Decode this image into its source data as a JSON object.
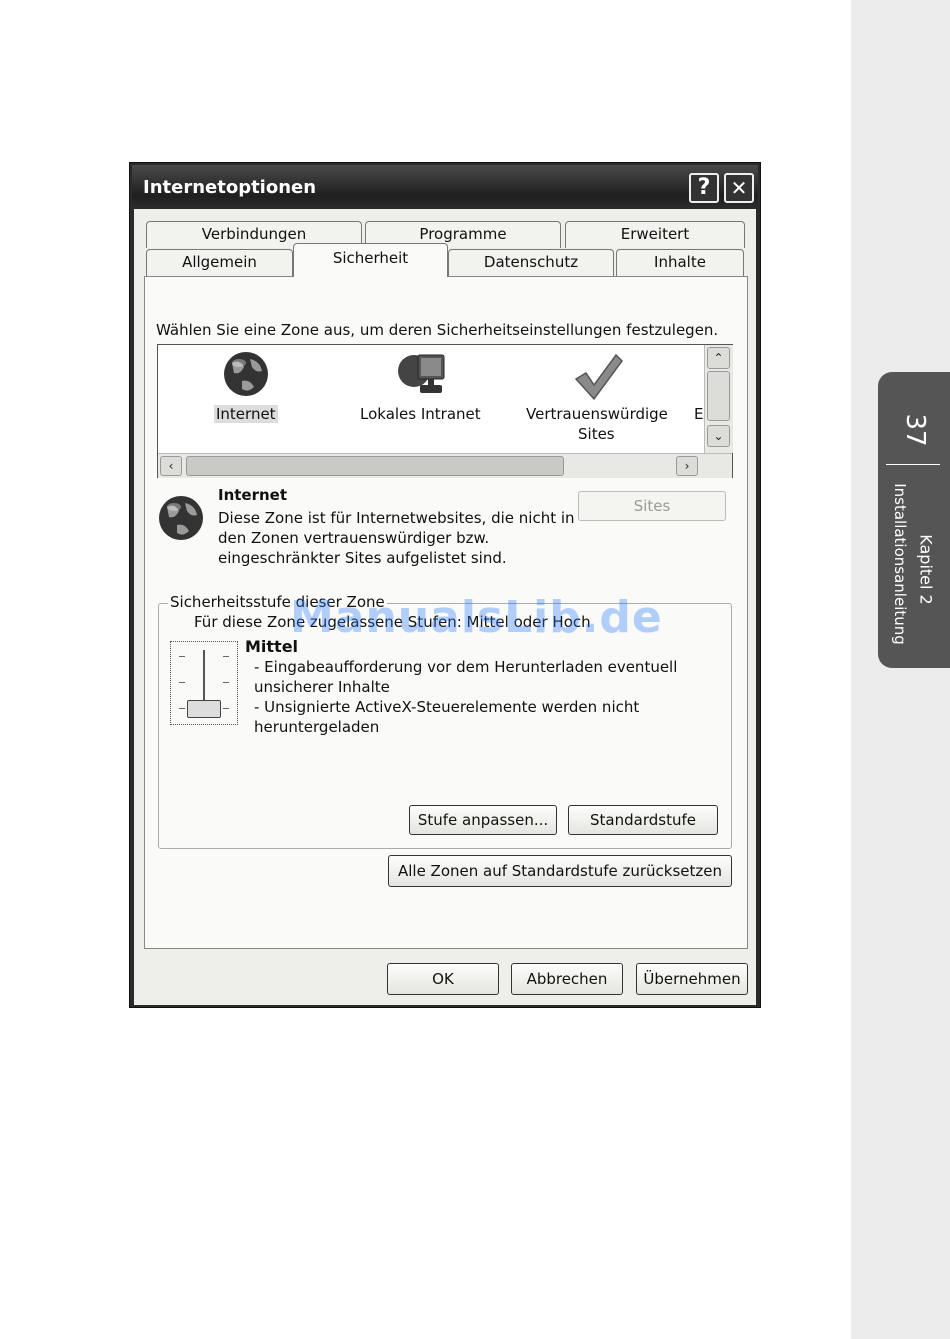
{
  "dialog": {
    "title": "Internetoptionen",
    "help_button": "?",
    "close_button": "✕"
  },
  "tabs_row_top": [
    "Verbindungen",
    "Programme",
    "Erweitert"
  ],
  "tabs_row_bottom": [
    "Allgemein",
    "Sicherheit",
    "Datenschutz",
    "Inhalte"
  ],
  "active_tab": "Sicherheit",
  "zone_prompt": "Wählen Sie eine Zone aus, um deren Sicherheitseinstellungen festzulegen.",
  "zones": [
    {
      "label": "Internet",
      "icon": "globe-icon"
    },
    {
      "label": "Lokales Intranet",
      "icon": "computer-icon"
    },
    {
      "label_line1": "Vertrauenswürdige",
      "label_line2": "Sites",
      "icon": "checkmark-icon"
    },
    {
      "label": "E",
      "icon": "restricted-icon"
    }
  ],
  "selected_zone": {
    "title": "Internet",
    "description_line1": "Diese Zone ist für Internetwebsites, die nicht in",
    "description_line2": "den Zonen vertrauenswürdiger bzw.",
    "description_line3": "eingeschränkter Sites aufgelistet sind.",
    "sites_button": "Sites"
  },
  "security_level": {
    "legend": "Sicherheitsstufe dieser Zone",
    "allowed_text": "Für diese Zone zugelassene Stufen: Mittel oder Hoch",
    "level_name": "Mittel",
    "bullet1_line1": "- Eingabeaufforderung vor dem Herunterladen eventuell",
    "bullet1_line2": "unsicherer Inhalte",
    "bullet2_line1": "- Unsignierte ActiveX-Steuerelemente werden nicht",
    "bullet2_line2": "heruntergeladen",
    "custom_button": "Stufe anpassen...",
    "default_button": "Standardstufe"
  },
  "reset_all_button": "Alle Zonen auf Standardstufe zurücksetzen",
  "footer_buttons": {
    "ok": "OK",
    "cancel": "Abbrechen",
    "apply": "Übernehmen"
  },
  "margin": {
    "page_number": "37",
    "chapter": "Kapitel 2",
    "chapter_subtitle": "Installationsanleitung"
  },
  "watermark": "ManualsLib.de"
}
